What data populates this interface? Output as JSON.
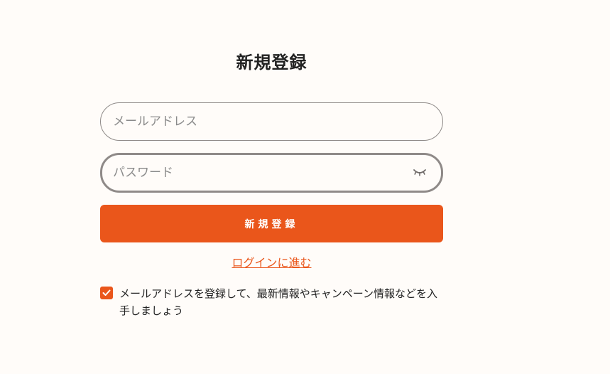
{
  "form": {
    "title": "新規登録",
    "email": {
      "placeholder": "メールアドレス",
      "value": ""
    },
    "password": {
      "placeholder": "パスワード",
      "value": "",
      "toggle_icon": "eye-closed-icon"
    },
    "submit_label": "新規登録",
    "login_link": "ログインに進む",
    "consent": {
      "checked": true,
      "text": "メールアドレスを登録して、最新情報やキャンペーン情報などを入手しましょう"
    }
  },
  "colors": {
    "accent": "#ea561b",
    "background": "#fffcf9",
    "border": "#8f8a88",
    "text": "#222222"
  }
}
